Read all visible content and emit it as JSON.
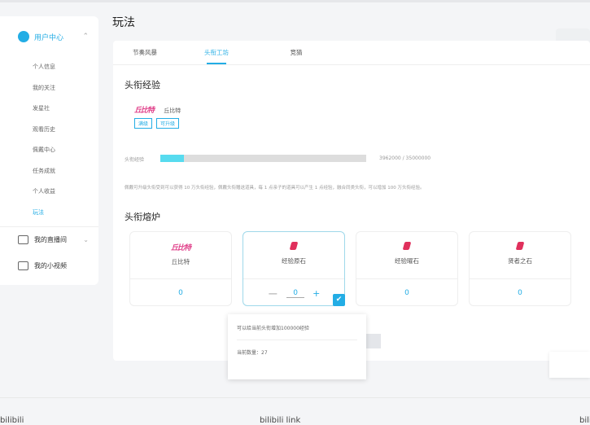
{
  "page_title": "玩法",
  "sidebar": {
    "header": "用户中心",
    "items": [
      "个人信息",
      "我的关注",
      "发星社",
      "观看历史",
      "佩戴中心",
      "任务成就",
      "个人收益",
      "玩法"
    ],
    "sections": [
      "我的直播间",
      "我的小视频"
    ]
  },
  "tabs": [
    "节奏风暴",
    "头衔工坊",
    "竞猜"
  ],
  "exp": {
    "title": "头衔经验",
    "title_name": "丘比特",
    "logo_text": "丘比特",
    "badges": [
      "满级",
      "可升级"
    ],
    "bar_label": "头衔经验",
    "progress_text": "3962000 / 35000000",
    "progress": 0.113,
    "description": "佩戴可升级头衔受到可以获得 10 万头衔经验，佩戴头衔赠送道具，每 1 点亲子的道具可以产生 1 点经验，融合同类头衔，可以增加 100 万头衔经验。"
  },
  "furnace": {
    "title": "头衔熔炉",
    "cards": [
      {
        "name": "丘比特",
        "value": "0"
      },
      {
        "name": "经验原石",
        "value": "0"
      },
      {
        "name": "经验曜石",
        "value": "0"
      },
      {
        "name": "贤者之石",
        "value": "0"
      }
    ],
    "minus": "−",
    "plus": "+"
  },
  "popover": {
    "desc": "可以给当前头衔增加100000经验",
    "count": "当前数量：27"
  },
  "footer": {
    "left": "bilibili",
    "center": "bilibili link",
    "right": "bili"
  }
}
